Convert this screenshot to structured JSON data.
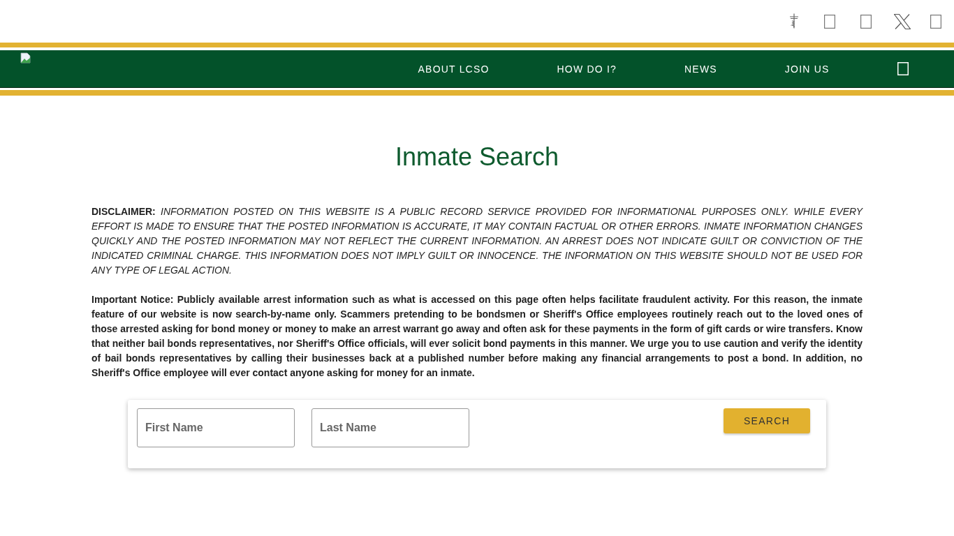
{
  "navigation": {
    "items": [
      {
        "label": "ABOUT LCSO"
      },
      {
        "label": "HOW DO I?"
      },
      {
        "label": "NEWS"
      },
      {
        "label": "JOIN US"
      }
    ]
  },
  "page": {
    "title": "Inmate Search",
    "disclaimer": "**DISCLAIMER:** *INFORMATION POSTED ON THIS WEBSITE IS A PUBLIC RECORD SERVICE PROVIDED FOR INFORMATIONAL PURPOSES ONLY. WHILE EVERY EFFORT IS MADE TO ENSURE THAT THE POSTED INFORMATION IS ACCURATE, IT MAY CONTAIN FACTUAL OR OTHER ERRORS. INMATE INFORMATION CHANGES QUICKLY AND THE POSTED INFORMATION MAY NOT REFLECT THE CURRENT INFORMATION. AN ARREST DOES NOT INDICATE GUILT OR CONVICTION OF THE INDICATED CRIMINAL CHARGE. THIS INFORMATION DOES NOT IMPLY GUILT OR INNOCENCE. THE INFORMATION ON THIS WEBSITE SHOULD NOT BE USED FOR ANY TYPE OF LEGAL ACTION.*",
    "notice": "Important Notice: Publicly available arrest information such as what is accessed on this page often helps facilitate fraudulent activity. For this reason, the inmate feature of our website is now search-by-name only. Scammers pretending to be bondsmen or Sheriff's Office employees routinely reach out to the loved ones of those arrested asking for bond money or money to make an arrest warrant go away and often ask for these payments in the form of gift cards or wire transfers. Know that neither bail bonds representatives, nor Sheriff's Office officials, will ever solicit bond payments in this manner. We urge you to use caution and verify the identity of bail bonds representatives by calling their businesses back at a published number before making any financial arrangements to post a bond. In addition, no Sheriff's Office employee will ever contact anyone asking for money for an inmate."
  },
  "search_form": {
    "fields": [
      {
        "placeholder": "First Name"
      },
      {
        "placeholder": "Last Name"
      }
    ],
    "button": "SEARCH"
  }
}
